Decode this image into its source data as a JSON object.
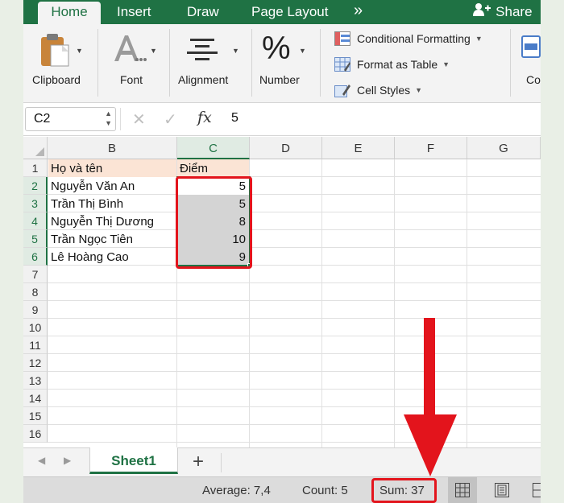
{
  "ribbon": {
    "tabs": [
      {
        "label": "Home",
        "active": true
      },
      {
        "label": "Insert"
      },
      {
        "label": "Draw"
      },
      {
        "label": "Page Layout"
      }
    ],
    "more_tabs_glyph": "»",
    "share_label": "Share",
    "groups": {
      "clipboard": "Clipboard",
      "font": "Font",
      "alignment": "Alignment",
      "number": "Number",
      "number_glyph": "%"
    },
    "styles": {
      "conditional_formatting": "Conditional Formatting",
      "format_as_table": "Format as Table",
      "cell_styles": "Cell Styles"
    },
    "cut_off_label": "Co"
  },
  "formula_bar": {
    "name_box": "C2",
    "fx_label": "fx",
    "value": "5"
  },
  "grid": {
    "columns": [
      "B",
      "C",
      "D",
      "E",
      "F",
      "G"
    ],
    "selected_column": "C",
    "rows": [
      "1",
      "2",
      "3",
      "4",
      "5",
      "6",
      "7",
      "8",
      "9",
      "10",
      "11",
      "12",
      "13",
      "14",
      "15",
      "16"
    ],
    "selected_rows": [
      "2",
      "3",
      "4",
      "5",
      "6"
    ],
    "header_row": {
      "b": "Họ và tên",
      "c": "Điểm"
    },
    "data_rows": [
      {
        "name": "Nguyễn Văn An",
        "score": "5"
      },
      {
        "name": "Trần Thị Bình",
        "score": "5"
      },
      {
        "name": "Nguyễn Thị Dương",
        "score": "8"
      },
      {
        "name": "Trần Ngọc Tiên",
        "score": "10"
      },
      {
        "name": "Lê Hoàng Cao",
        "score": "9"
      }
    ]
  },
  "sheet_tabs": {
    "active": "Sheet1",
    "add_glyph": "+"
  },
  "status_bar": {
    "average": "Average: 7,4",
    "count": "Count: 5",
    "sum": "Sum: 37"
  },
  "colors": {
    "excel_green": "#1f7244",
    "highlight_red": "#e3141c",
    "header_fill": "#fbe4d5",
    "selection_gray": "#d4d4d4"
  }
}
